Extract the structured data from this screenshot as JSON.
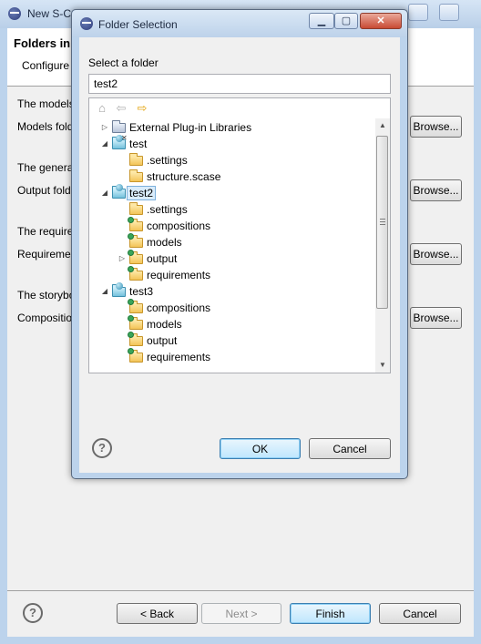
{
  "wizard": {
    "title": "New S-CASE Project",
    "header_title": "Folders in",
    "header_subtitle": "Configure",
    "rows": [
      {
        "desc": "The models",
        "label": "Models fold",
        "browse": "Browse..."
      },
      {
        "desc": "The genera",
        "label": "Output fold",
        "browse": "Browse..."
      },
      {
        "desc": "The require",
        "label": "Requiremen",
        "browse": "Browse..."
      },
      {
        "desc": "The storybo",
        "label": "Compositio",
        "browse": "Browse..."
      }
    ],
    "buttons": {
      "help": "?",
      "back": "< Back",
      "next": "Next >",
      "finish": "Finish",
      "cancel": "Cancel"
    }
  },
  "dialog": {
    "title": "Folder Selection",
    "label": "Select a folder",
    "input_value": "test2",
    "buttons": {
      "ok": "OK",
      "cancel": "Cancel",
      "help": "?"
    },
    "toolbar": [
      {
        "icon": "home-icon",
        "glyph": "⌂",
        "color": "#9a9a9a"
      },
      {
        "icon": "back-arrow-icon",
        "glyph": "⇦",
        "color": "#b0b0b0"
      },
      {
        "icon": "forward-arrow-icon",
        "glyph": "⇨",
        "color": "#e3a20a"
      }
    ],
    "tree": [
      {
        "label": "External Plug-in Libraries",
        "level": 0,
        "twisty": "collapsed",
        "icon": "library-folder-icon"
      },
      {
        "label": "test",
        "level": 0,
        "twisty": "expanded",
        "icon": "project-icon"
      },
      {
        "label": ".settings",
        "level": 1,
        "twisty": "none",
        "icon": "folder-icon"
      },
      {
        "label": "structure.scase",
        "level": 1,
        "twisty": "none",
        "icon": "folder-icon"
      },
      {
        "label": "test2",
        "level": 0,
        "twisty": "expanded",
        "icon": "project-icon",
        "selected": true
      },
      {
        "label": ".settings",
        "level": 1,
        "twisty": "none",
        "icon": "folder-icon"
      },
      {
        "label": "compositions",
        "level": 1,
        "twisty": "none",
        "icon": "source-folder-icon"
      },
      {
        "label": "models",
        "level": 1,
        "twisty": "none",
        "icon": "source-folder-icon"
      },
      {
        "label": "output",
        "level": 1,
        "twisty": "collapsed",
        "icon": "source-folder-icon"
      },
      {
        "label": "requirements",
        "level": 1,
        "twisty": "none",
        "icon": "source-folder-icon"
      },
      {
        "label": "test3",
        "level": 0,
        "twisty": "expanded",
        "icon": "project-icon"
      },
      {
        "label": "compositions",
        "level": 1,
        "twisty": "none",
        "icon": "source-folder-icon"
      },
      {
        "label": "models",
        "level": 1,
        "twisty": "none",
        "icon": "source-folder-icon"
      },
      {
        "label": "output",
        "level": 1,
        "twisty": "none",
        "icon": "source-folder-icon"
      },
      {
        "label": "requirements",
        "level": 1,
        "twisty": "none",
        "icon": "source-folder-icon"
      }
    ]
  }
}
